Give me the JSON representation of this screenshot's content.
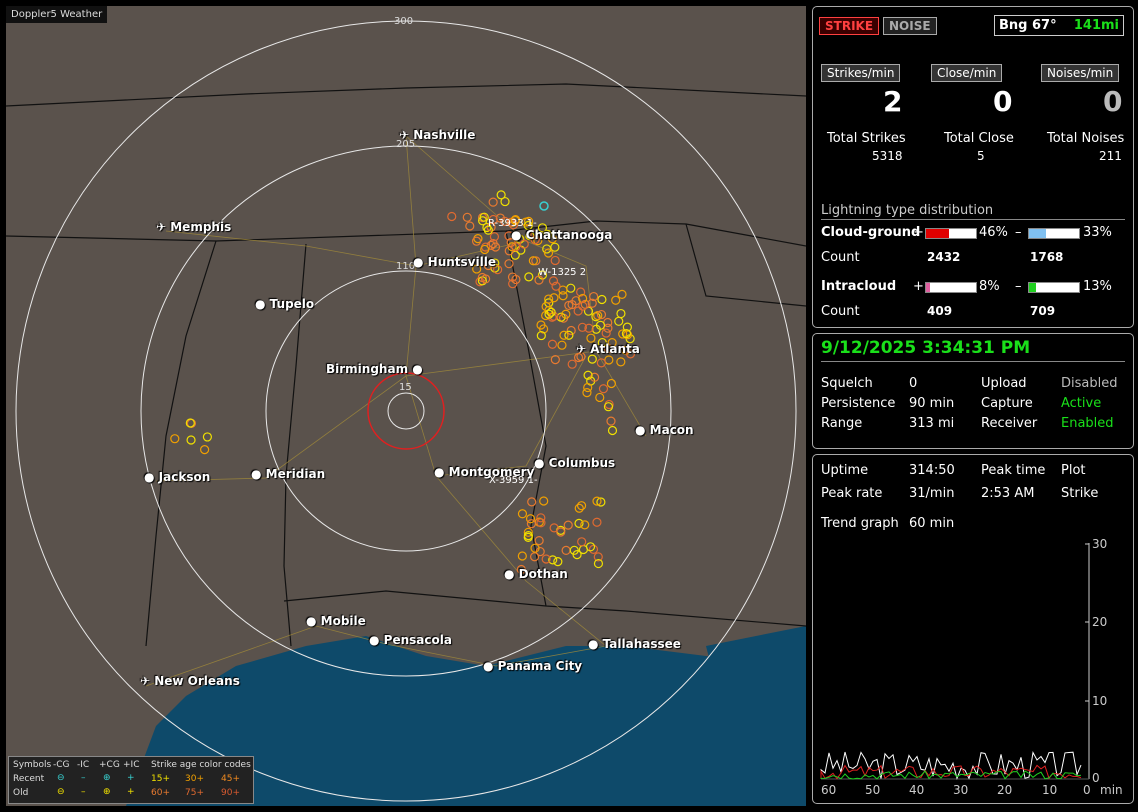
{
  "app": {
    "title": "Doppler5 Weather"
  },
  "map": {
    "range_labels": [
      "300",
      "205",
      "110",
      "15"
    ],
    "cities": [
      {
        "name": "Nashville"
      },
      {
        "name": "Memphis"
      },
      {
        "name": "Chattanooga"
      },
      {
        "name": "Huntsville"
      },
      {
        "name": "Tupelo"
      },
      {
        "name": "Birmingham"
      },
      {
        "name": "Atlanta"
      },
      {
        "name": "Macon"
      },
      {
        "name": "Columbus"
      },
      {
        "name": "Montgomery"
      },
      {
        "name": "Meridian"
      },
      {
        "name": "Jackson"
      },
      {
        "name": "Dothan"
      },
      {
        "name": "Mobile"
      },
      {
        "name": "Pensacola"
      },
      {
        "name": "Tallahassee"
      },
      {
        "name": "Panama City"
      },
      {
        "name": "New Orleans"
      }
    ],
    "cell_labels": [
      "R-3933 1-",
      "W-1325 2",
      "X-3959 1-"
    ]
  },
  "legend": {
    "symbols_label": "Symbols",
    "neg_cg": "-CG",
    "neg_ic": "-IC",
    "pos_cg": "+CG",
    "pos_ic": "+IC",
    "age_title": "Strike age color codes",
    "recent": "Recent",
    "old": "Old",
    "ages_recent": [
      "15+",
      "30+",
      "45+"
    ],
    "ages_old": [
      "60+",
      "75+",
      "90+"
    ]
  },
  "status": {
    "strike_btn": "STRIKE",
    "noise_btn": "NOISE",
    "bearing": "Bng 67°",
    "distance": "141mi",
    "strikes_min_label": "Strikes/min",
    "close_min_label": "Close/min",
    "noises_min_label": "Noises/min",
    "strikes_min": "2",
    "close_min": "0",
    "noises_min": "0",
    "total_strikes_label": "Total Strikes",
    "total_close_label": "Total Close",
    "total_noises_label": "Total Noises",
    "total_strikes": "5318",
    "total_close": "5",
    "total_noises": "211",
    "dist_title": "Lightning type distribution",
    "cg_label": "Cloud-ground",
    "cg_plus_pct": "46%",
    "cg_minus_pct": "33%",
    "cg_plus_frac": 0.46,
    "cg_minus_frac": 0.33,
    "count_label": "Count",
    "cg_plus_count": "2432",
    "cg_minus_count": "1768",
    "ic_label": "Intracloud",
    "ic_plus_pct": "8%",
    "ic_minus_pct": "13%",
    "ic_plus_frac": 0.08,
    "ic_minus_frac": 0.13,
    "ic_plus_count": "409",
    "ic_minus_count": "709",
    "plus": "+",
    "minus": "–"
  },
  "info": {
    "datetime": "9/12/2025 3:34:31 PM",
    "squelch_label": "Squelch",
    "squelch": "0",
    "upload_label": "Upload",
    "upload": "Disabled",
    "persistence_label": "Persistence",
    "persistence": "90 min",
    "capture_label": "Capture",
    "capture": "Active",
    "range_label": "Range",
    "range": "313 mi",
    "receiver_label": "Receiver",
    "receiver": "Enabled"
  },
  "trend": {
    "uptime_label": "Uptime",
    "uptime": "314:50",
    "peak_time_label": "Peak time",
    "peak_time": "2:53 AM",
    "plot_label": "Plot",
    "peak_rate_label": "Peak rate",
    "peak_rate": "31/min",
    "plot": "Strike",
    "trend_label": "Trend graph",
    "trend_value": "60 min",
    "y_labels": [
      "30",
      "20",
      "10",
      "0"
    ],
    "x_labels": [
      "60",
      "50",
      "40",
      "30",
      "20",
      "10",
      "0"
    ],
    "x_unit": "min"
  }
}
